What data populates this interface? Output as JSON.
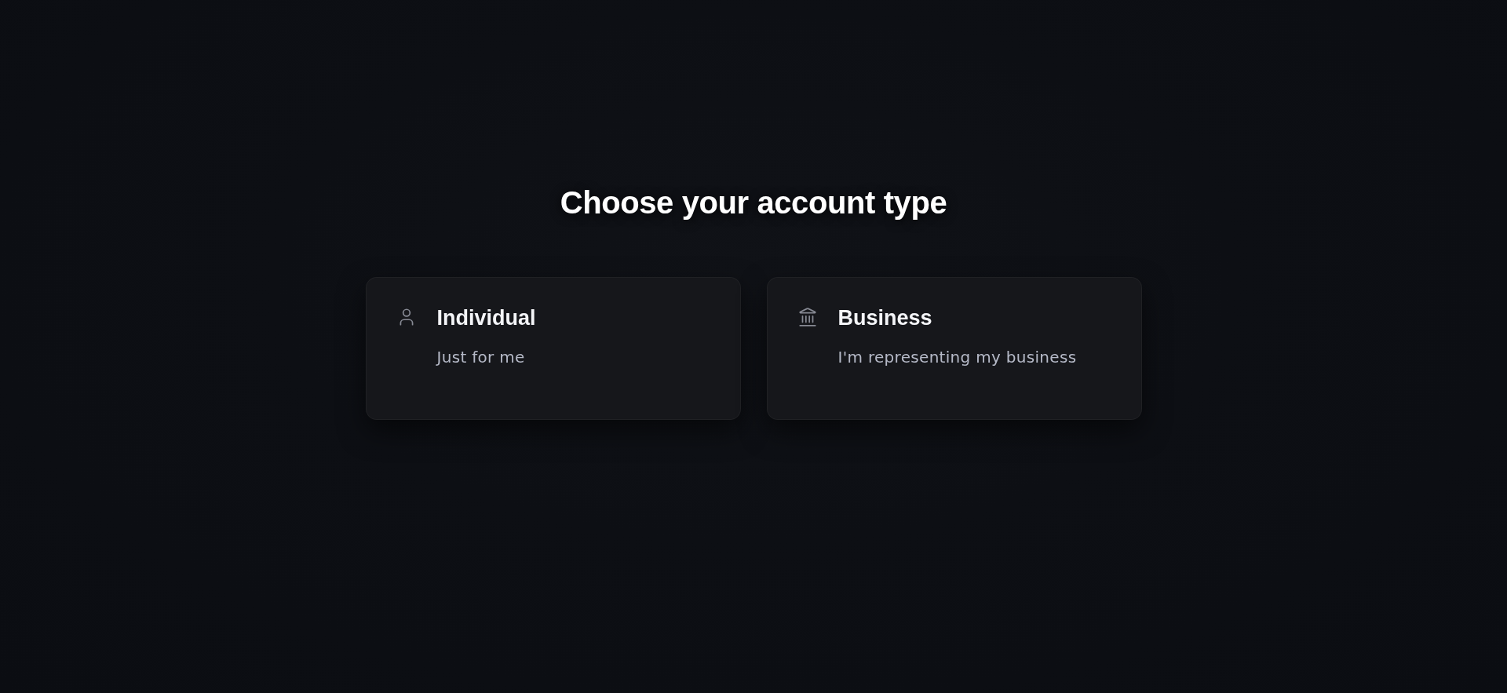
{
  "heading": "Choose your account type",
  "options": [
    {
      "kind": "individual",
      "title": "Individual",
      "description": "Just for me",
      "selected": false
    },
    {
      "kind": "business",
      "title": "Business",
      "description": "I'm representing my business",
      "selected": false
    }
  ]
}
